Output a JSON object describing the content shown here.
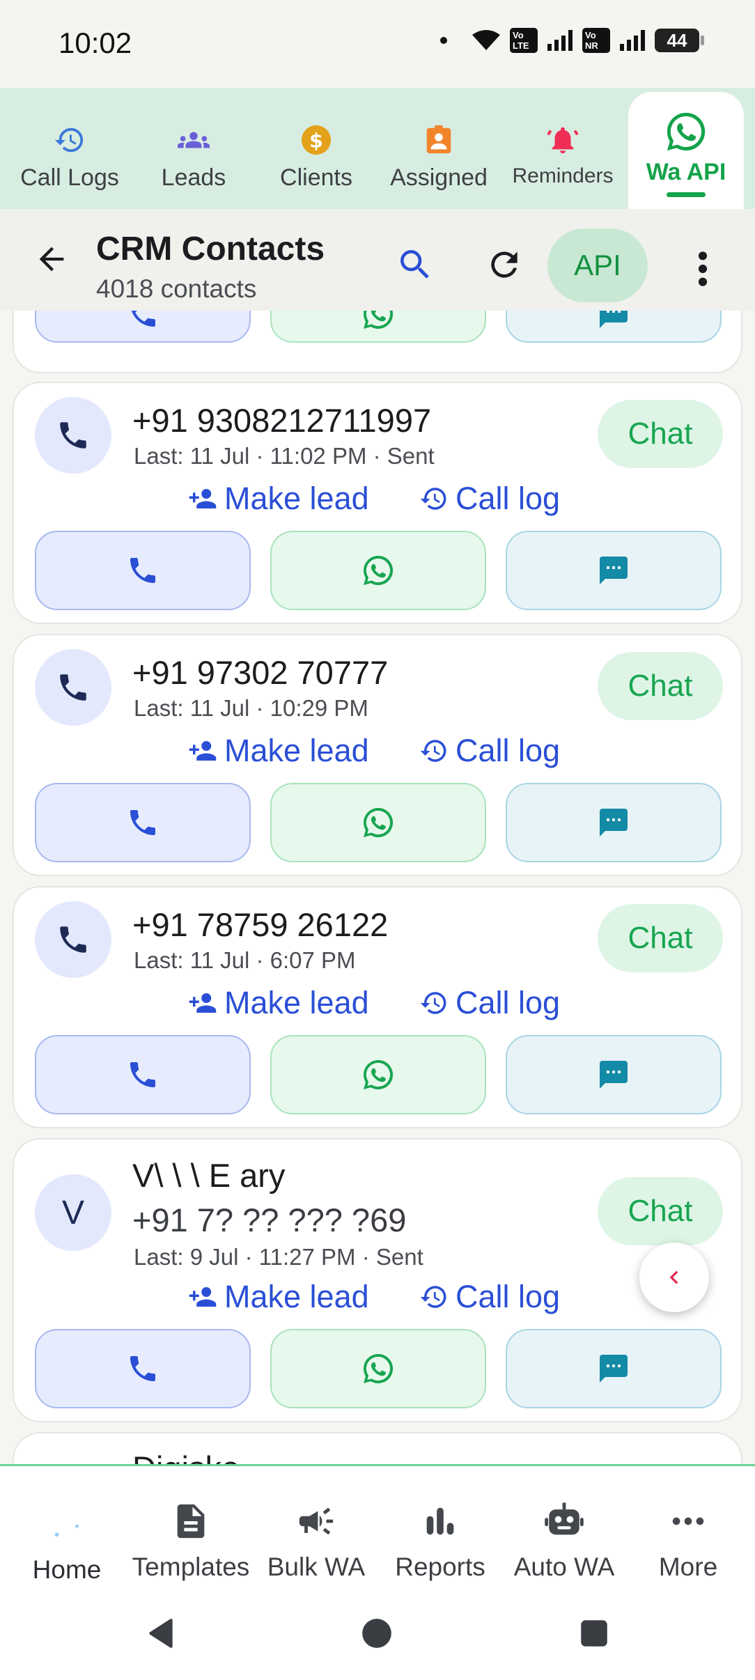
{
  "status_bar": {
    "time": "10:02",
    "sim1": "Vo 2 LTE",
    "sim2": "Vo 1 NR",
    "battery": "44"
  },
  "top_tabs": [
    {
      "label": "Call Logs",
      "icon": "history-icon",
      "color": "#3b79d8"
    },
    {
      "label": "Leads",
      "icon": "group-icon",
      "color": "#6a5fd8"
    },
    {
      "label": "Clients",
      "icon": "dollar-icon",
      "color": "#e3a21a"
    },
    {
      "label": "Assigned",
      "icon": "assignment-ind-icon",
      "color": "#f2842b"
    },
    {
      "label": "Reminders",
      "icon": "bell-icon",
      "color": "#ef2d56"
    },
    {
      "label": "Wa API",
      "icon": "whatsapp-icon",
      "color": "#14a34a",
      "active": true
    }
  ],
  "app_bar": {
    "title": "CRM Contacts",
    "subtitle": "4018 contacts",
    "api_label": "API"
  },
  "contacts": [
    {
      "phone": "+91 9308212711997",
      "last": "Last: 11 Jul · 11:02 PM · Sent",
      "chat": "Chat",
      "make_lead": "Make lead",
      "call_log": "Call log"
    },
    {
      "phone": "+91 97302 70777",
      "last": "Last: 11 Jul · 10:29 PM",
      "chat": "Chat",
      "make_lead": "Make lead",
      "call_log": "Call log"
    },
    {
      "phone": "+91 78759 26122",
      "last": "Last: 11 Jul · 6:07 PM",
      "chat": "Chat",
      "make_lead": "Make lead",
      "call_log": "Call log"
    },
    {
      "initial": "V",
      "name": "V\\ \\ \\  E ary",
      "phone": "+91 7? ?? ??? ?69",
      "last": "Last: 9 Jul · 11:27 PM · Sent",
      "chat": "Chat",
      "make_lead": "Make lead",
      "call_log": "Call log"
    }
  ],
  "next_contact_partial_name": "Digiske",
  "bottom_nav": [
    {
      "label": "Home",
      "icon": "home-icon"
    },
    {
      "label": "Templates",
      "icon": "document-icon"
    },
    {
      "label": "Bulk WA",
      "icon": "campaign-icon"
    },
    {
      "label": "Reports",
      "icon": "bar-chart-icon"
    },
    {
      "label": "Auto WA",
      "icon": "robot-icon"
    },
    {
      "label": "More",
      "icon": "more-horiz-icon"
    }
  ]
}
